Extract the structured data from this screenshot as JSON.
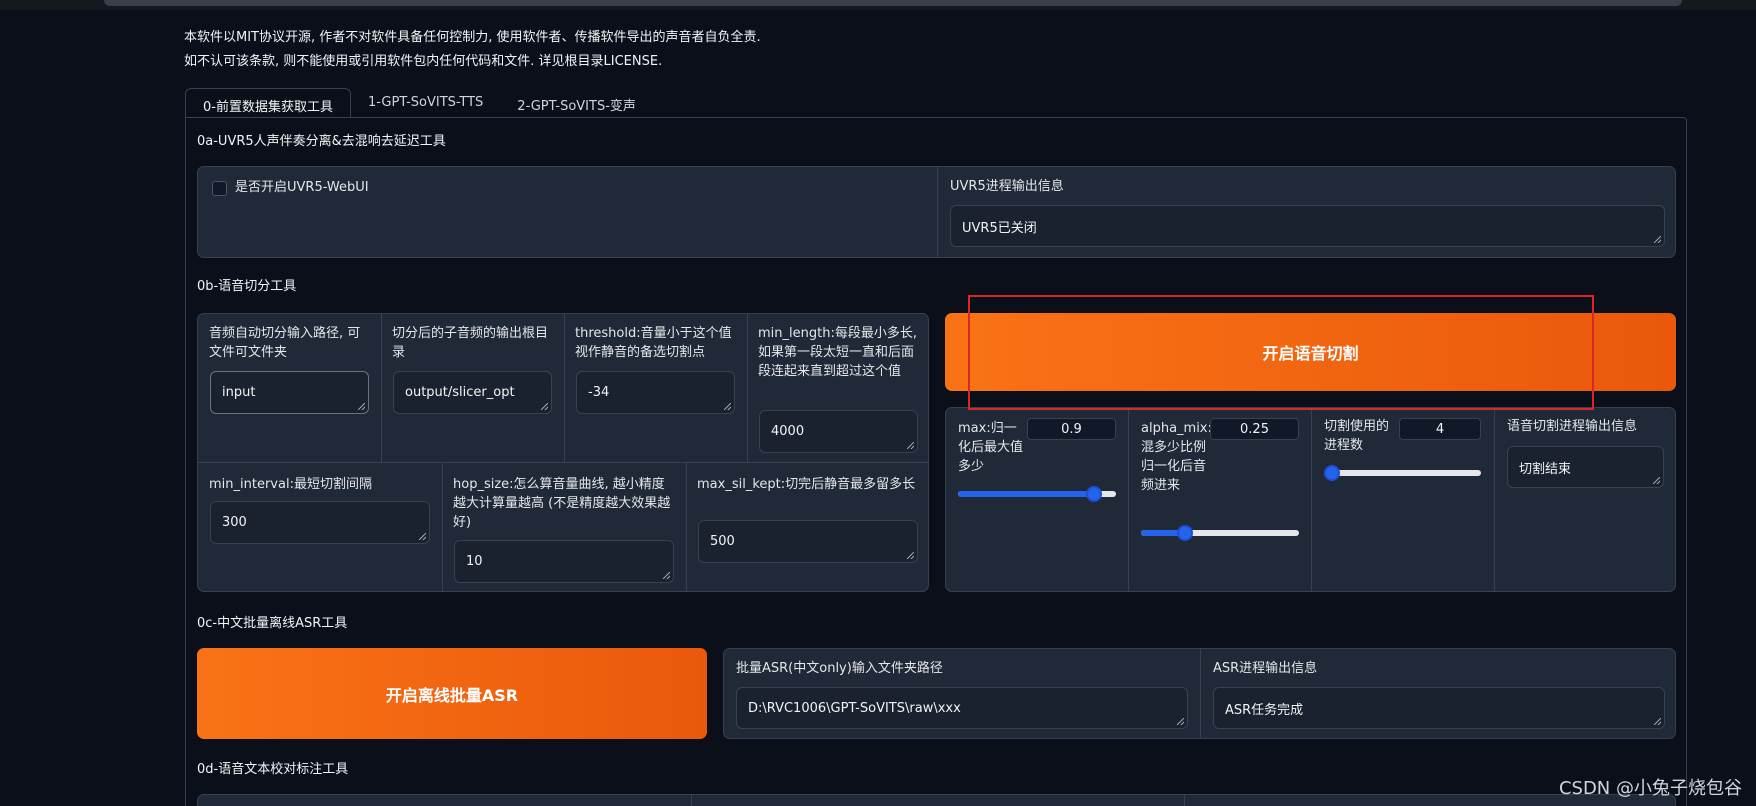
{
  "notice": {
    "line1": "本软件以MIT协议开源, 作者不对软件具备任何控制力, 使用软件者、传播软件导出的声音者自负全责.",
    "line2": "如不认可该条款, 则不能使用或引用软件包内任何代码和文件. 详见根目录LICENSE."
  },
  "tabs": [
    "0-前置数据集获取工具",
    "1-GPT-SoVITS-TTS",
    "2-GPT-SoVITS-变声"
  ],
  "uvr5": {
    "title": "0a-UVR5人声伴奏分离&去混响去延迟工具",
    "checkbox_label": "是否开启UVR5-WebUI",
    "output_label": "UVR5进程输出信息",
    "output_value": "UVR5已关闭"
  },
  "slicer": {
    "title": "0b-语音切分工具",
    "input_path_label": "音频自动切分输入路径, 可文件可文件夹",
    "input_path_value": "input",
    "output_dir_label": "切分后的子音频的输出根目录",
    "output_dir_value": "output/slicer_opt",
    "threshold_label": "threshold:音量小于这个值视作静音的备选切割点",
    "threshold_value": "-34",
    "min_length_label": "min_length:每段最小多长, 如果第一段太短一直和后面段连起来直到超过这个值",
    "min_length_value": "4000",
    "min_interval_label": "min_interval:最短切割间隔",
    "min_interval_value": "300",
    "hop_size_label": "hop_size:怎么算音量曲线, 越小精度越大计算量越高 (不是精度越大效果越好)",
    "hop_size_value": "10",
    "max_sil_kept_label": "max_sil_kept:切完后静音最多留多长",
    "max_sil_kept_value": "500",
    "start_button": "开启语音切割",
    "max_label": "max:归一化后最大值多少",
    "max_value": "0.9",
    "max_fraction": 0.9,
    "alpha_label": "alpha_mix:混多少比例归一化后音频进来",
    "alpha_value": "0.25",
    "alpha_fraction": 0.25,
    "procs_label": "切割使用的进程数",
    "procs_value": "4",
    "procs_fraction": 0.0,
    "progress_label": "语音切割进程输出信息",
    "progress_value": "切割结束"
  },
  "asr": {
    "title": "0c-中文批量离线ASR工具",
    "start_button": "开启离线批量ASR",
    "input_label": "批量ASR(中文only)输入文件夹路径",
    "input_value": "D:\\RVC1006\\GPT-SoVITS\\raw\\xxx",
    "output_label": "ASR进程输出信息",
    "output_value": "ASR任务完成"
  },
  "labeling": {
    "title": "0d-语音文本校对标注工具"
  },
  "watermark": "CSDN @小兔子烧包谷",
  "colors": {
    "accent_orange": "#f97316",
    "slider_blue": "#2563eb",
    "highlight_red": "#dc2626"
  }
}
